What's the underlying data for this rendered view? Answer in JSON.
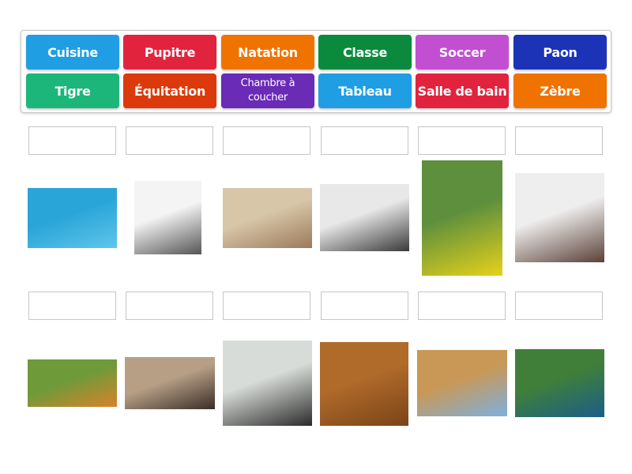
{
  "tiles": [
    {
      "label": "Cuisine",
      "color": "#1f9ee4"
    },
    {
      "label": "Pupitre",
      "color": "#e2233e"
    },
    {
      "label": "Natation",
      "color": "#f07300"
    },
    {
      "label": "Classe",
      "color": "#0b8a3e"
    },
    {
      "label": "Soccer",
      "color": "#c24fd2"
    },
    {
      "label": "Paon",
      "color": "#1c33b8"
    },
    {
      "label": "Tigre",
      "color": "#1cb67a"
    },
    {
      "label": "Équitation",
      "color": "#dc3a0c"
    },
    {
      "label": "Chambre à coucher",
      "color": "#6a2bb7"
    },
    {
      "label": "Tableau",
      "color": "#1f9ee4"
    },
    {
      "label": "Salle de bain",
      "color": "#e2233e"
    },
    {
      "label": "Zèbre",
      "color": "#f07300"
    }
  ],
  "images": [
    {
      "subject": "swimmer",
      "colors": [
        "#2aa5d8",
        "#5fc6ea"
      ]
    },
    {
      "subject": "whiteboard",
      "colors": [
        "#f4f4f4",
        "#555555"
      ]
    },
    {
      "subject": "classroom",
      "colors": [
        "#d8c6a8",
        "#9a7a5a"
      ]
    },
    {
      "subject": "kitchen",
      "colors": [
        "#e8e8e8",
        "#3a3a3a"
      ]
    },
    {
      "subject": "soccer-player",
      "colors": [
        "#5d8f3d",
        "#e6d21a"
      ]
    },
    {
      "subject": "bedroom",
      "colors": [
        "#eeeeee",
        "#5a4036"
      ]
    },
    {
      "subject": "tiger",
      "colors": [
        "#6f9a3a",
        "#d9822b"
      ]
    },
    {
      "subject": "zebra",
      "colors": [
        "#b79f86",
        "#3a2e28"
      ]
    },
    {
      "subject": "bathroom",
      "colors": [
        "#d8dcd8",
        "#2b2b2b"
      ]
    },
    {
      "subject": "school-desk",
      "colors": [
        "#b06a2a",
        "#7a4418"
      ]
    },
    {
      "subject": "horse-rider",
      "colors": [
        "#c99856",
        "#7db0e0"
      ]
    },
    {
      "subject": "peacock",
      "colors": [
        "#3f7f3a",
        "#1b5d8a"
      ]
    }
  ]
}
